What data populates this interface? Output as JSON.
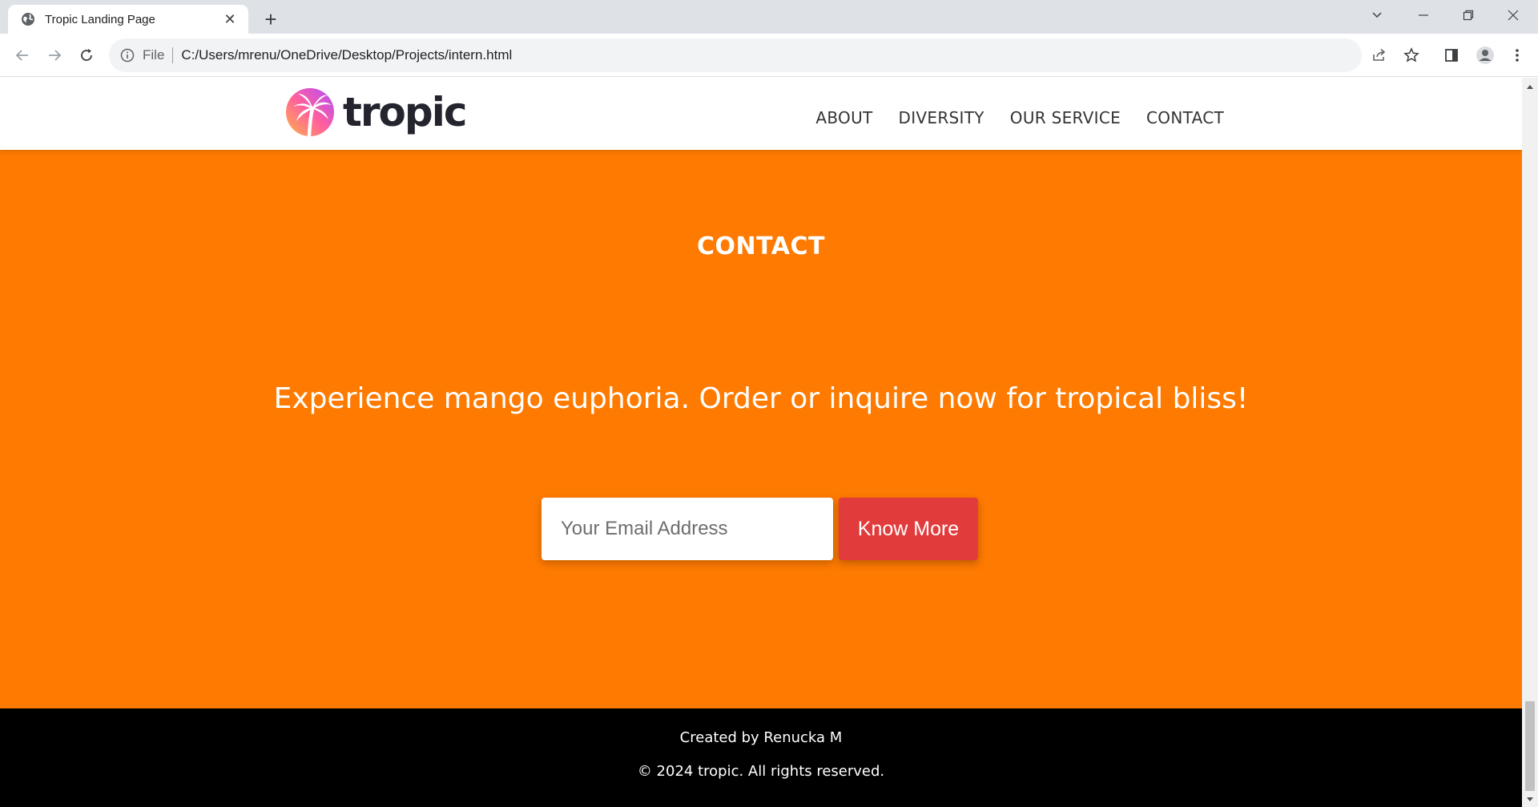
{
  "browser": {
    "tab_title": "Tropic Landing Page",
    "tab_close": "✕",
    "new_tab": "+",
    "omnibox_scheme": "File",
    "omnibox_url": "C:/Users/mrenu/OneDrive/Desktop/Projects/intern.html"
  },
  "site": {
    "logo_text": "tropic",
    "nav": [
      "ABOUT",
      "DIVERSITY",
      "OUR SERVICE",
      "CONTACT"
    ]
  },
  "contact": {
    "title": "CONTACT",
    "subtitle": "Experience mango euphoria. Order or inquire now for tropical bliss!",
    "email_placeholder": "Your Email Address",
    "button_label": "Know More"
  },
  "footer": {
    "created_by": "Created by Renucka M",
    "copyright": "© 2024 tropic. All rights reserved."
  },
  "colors": {
    "brand_orange": "#fe7a00",
    "button_red": "#e23b3b",
    "footer_bg": "#000000"
  },
  "icons": [
    "globe-icon",
    "close-icon",
    "plus-icon",
    "back-icon",
    "forward-icon",
    "reload-icon",
    "info-icon",
    "share-icon",
    "star-icon",
    "side-panel-icon",
    "profile-icon",
    "menu-icon",
    "chevron-down-icon",
    "minimize-icon",
    "restore-icon",
    "window-close-icon",
    "palm-logo-icon"
  ]
}
